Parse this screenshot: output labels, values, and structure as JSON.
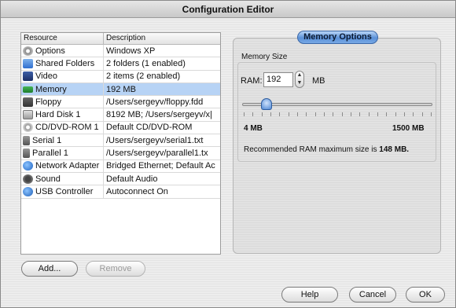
{
  "window": {
    "title": "Configuration Editor"
  },
  "table": {
    "headers": {
      "resource": "Resource",
      "description": "Description"
    },
    "rows": [
      {
        "resource": "Options",
        "description": "Windows XP",
        "icon": "gear-icon"
      },
      {
        "resource": "Shared Folders",
        "description": "2 folders (1 enabled)",
        "icon": "shared-folder-icon"
      },
      {
        "resource": "Video",
        "description": "2 items (2 enabled)",
        "icon": "video-icon"
      },
      {
        "resource": "Memory",
        "description": "192 MB",
        "icon": "memory-icon",
        "selected": true
      },
      {
        "resource": "Floppy",
        "description": "/Users/sergeyv/floppy.fdd",
        "icon": "floppy-icon"
      },
      {
        "resource": "Hard Disk 1",
        "description": "8192 MB; /Users/sergeyv/x|",
        "icon": "hard-disk-icon"
      },
      {
        "resource": "CD/DVD-ROM 1",
        "description": "Default CD/DVD-ROM",
        "icon": "cd-icon"
      },
      {
        "resource": "Serial 1",
        "description": "/Users/sergeyv/serial1.txt",
        "icon": "serial-port-icon"
      },
      {
        "resource": "Parallel 1",
        "description": "/Users/sergeyv/parallel1.tx",
        "icon": "parallel-port-icon"
      },
      {
        "resource": "Network Adapter",
        "description": "Bridged Ethernet; Default Ac",
        "icon": "network-icon"
      },
      {
        "resource": "Sound",
        "description": "Default Audio",
        "icon": "sound-icon"
      },
      {
        "resource": "USB Controller",
        "description": "Autoconnect On",
        "icon": "usb-icon"
      }
    ]
  },
  "buttons": {
    "add": "Add...",
    "remove": "Remove",
    "help": "Help",
    "cancel": "Cancel",
    "ok": "OK"
  },
  "memory": {
    "tab_label": "Memory Options",
    "group_title": "Memory Size",
    "ram_label": "RAM:",
    "ram_value": "192",
    "unit": "MB",
    "slider_min_label": "4 MB",
    "slider_max_label": "1500 MB",
    "slider_fraction": 0.12,
    "recommend_text": "Recommended RAM maximum size is",
    "recommend_value": "148",
    "recommend_suffix": "MB."
  },
  "colors": {
    "selection": "#b7d3f5",
    "accent": "#5b91d8"
  }
}
